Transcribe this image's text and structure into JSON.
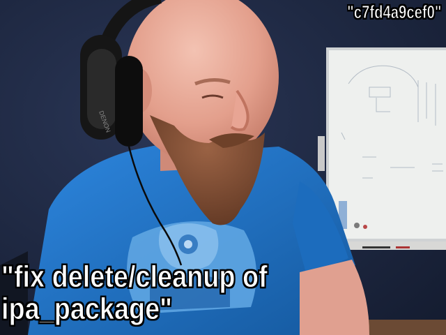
{
  "overlay": {
    "commit_hash": "\"c7fd4a9cef0\"",
    "commit_message_line1": "\"fix delete/cleanup of",
    "commit_message_line2": "ipa_package\""
  },
  "scene": {
    "description_items": [
      "person-with-headphones",
      "whiteboard",
      "blue-t-shirt"
    ],
    "colors": {
      "wall": "#1e2a44",
      "shirt": "#1f74c9",
      "skin": "#e3a191",
      "beard": "#7a4a30",
      "headphones": "#151515",
      "whiteboard": "#eeeeea"
    }
  }
}
